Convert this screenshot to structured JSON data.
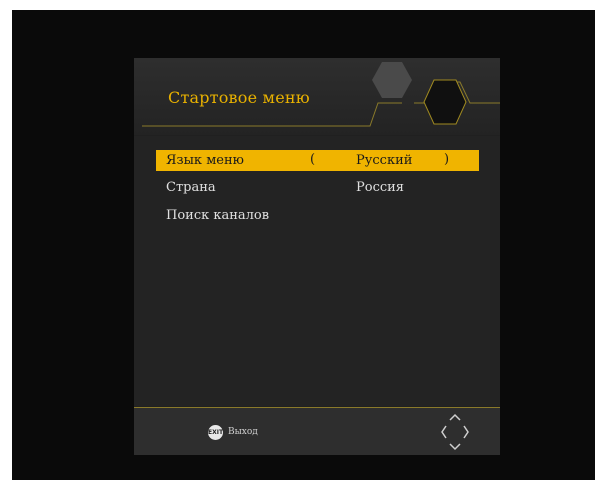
{
  "menu": {
    "title": "Стартовое меню",
    "items": [
      {
        "label": "Язык меню",
        "value": "Русский",
        "arrow_left": "(",
        "arrow_right": ")"
      },
      {
        "label": "Страна",
        "value": "Россия"
      },
      {
        "label": "Поиск каналов"
      }
    ]
  },
  "footer": {
    "exit_button": "EXIT",
    "exit_label": "Выход"
  },
  "icons": {
    "exit": "exit-button-icon",
    "nav": "navigation-arrows-icon",
    "decor": "hexagon-decor-icon"
  },
  "colors": {
    "accent": "#f0b400",
    "title": "#e8b100",
    "panel": "#202020",
    "background": "#0a0a0a"
  }
}
